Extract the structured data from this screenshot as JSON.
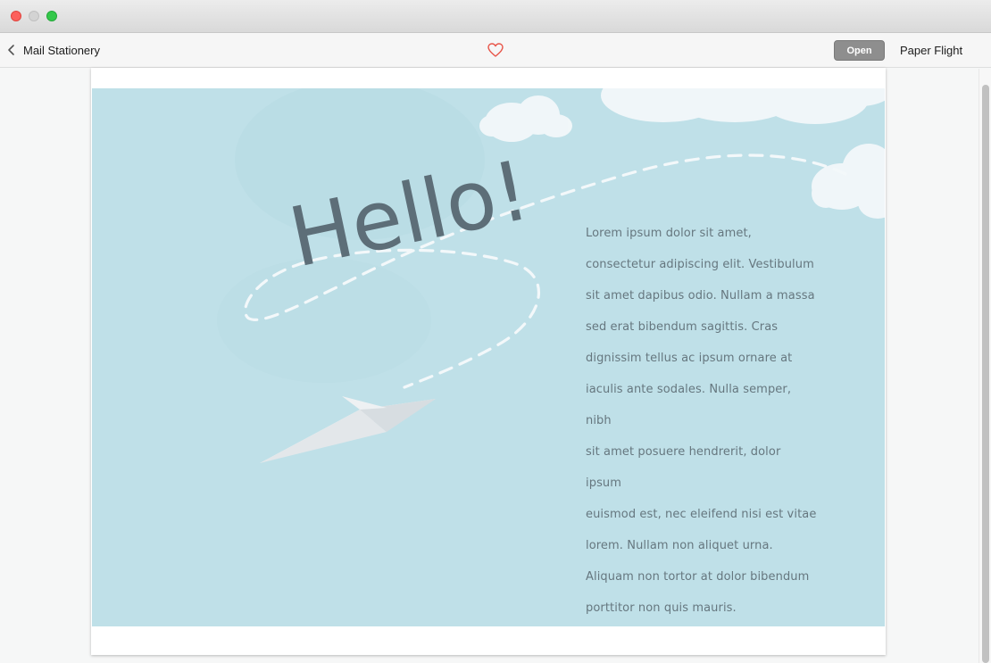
{
  "toolbar": {
    "back_label": "Mail Stationery",
    "open_label": "Open",
    "title": "Paper Flight"
  },
  "stationery": {
    "headline": "Hello!",
    "lines": [
      "Lorem ipsum dolor sit amet,",
      "consectetur adipiscing elit. Vestibulum",
      "sit amet dapibus odio. Nullam a massa",
      "sed erat bibendum sagittis. Cras",
      "dignissim tellus ac ipsum ornare at",
      "iaculis ante sodales. Nulla semper, nibh",
      "sit amet posuere hendrerit, dolor ipsum",
      "euismod est, nec eleifend nisi est vitae",
      "lorem. Nullam non aliquet urna.",
      "Aliquam non tortor at dolor bibendum",
      "porttitor non quis mauris."
    ]
  },
  "icons": {
    "back": "chevron-left-icon",
    "favorite": "heart-outline-icon"
  },
  "colors": {
    "sky": "#bfe0e8",
    "heart": "#e8564a",
    "open_button": "#8e8e8e",
    "headline": "#5d6e78"
  }
}
